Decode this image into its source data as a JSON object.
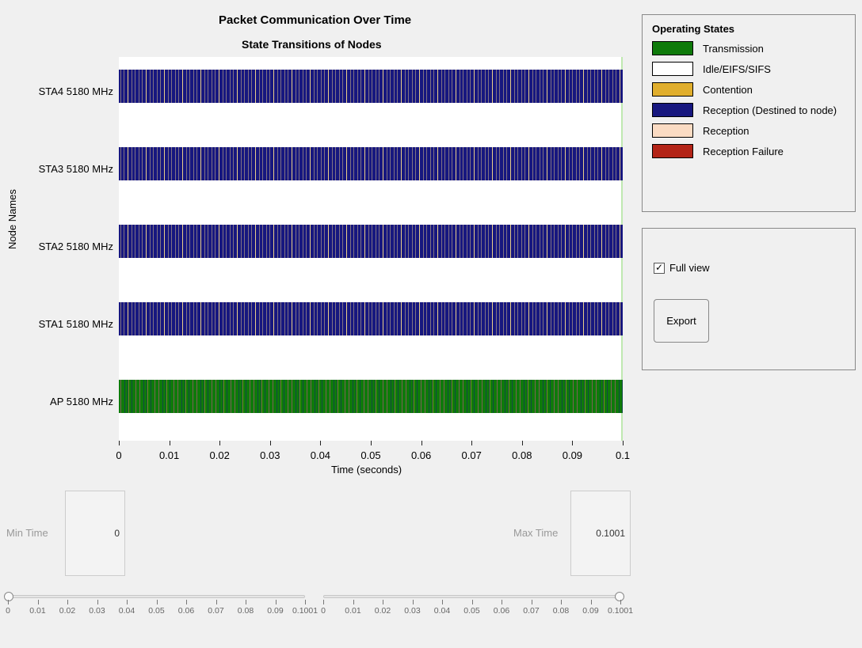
{
  "titles": {
    "main": "Packet Communication Over Time",
    "sub": "State Transitions of Nodes",
    "ylabel": "Node Names",
    "xlabel": "Time (seconds)"
  },
  "legend": {
    "title": "Operating States",
    "items": {
      "tx": "Transmission",
      "idle": "Idle/EIFS/SIFS",
      "cont": "Contention",
      "rxd": "Reception (Destined to node)",
      "rx": "Reception",
      "rxf": "Reception Failure"
    }
  },
  "controls": {
    "fullview": "Full view",
    "export": "Export"
  },
  "time_inputs": {
    "min_label": "Min Time",
    "max_label": "Max Time",
    "min_val": "0",
    "max_val": "0.1001"
  },
  "chart_data": {
    "type": "timeline/state-gantt",
    "title": "Packet Communication Over Time",
    "subtitle": "State Transitions of Nodes",
    "xlabel": "Time (seconds)",
    "ylabel": "Node Names",
    "xlim": [
      0,
      0.1
    ],
    "x_ticks": [
      0,
      0.01,
      0.02,
      0.03,
      0.04,
      0.05,
      0.06,
      0.07,
      0.08,
      0.09,
      0.1
    ],
    "nodes": [
      "STA4 5180 MHz",
      "STA3 5180 MHz",
      "STA2 5180 MHz",
      "STA1 5180 MHz",
      "AP 5180 MHz"
    ],
    "states": [
      "Transmission",
      "Idle/EIFS/SIFS",
      "Contention",
      "Reception (Destined to node)",
      "Reception",
      "Reception Failure"
    ],
    "state_colors": {
      "Transmission": "#0e7a0a",
      "Idle/EIFS/SIFS": "#ffffff",
      "Contention": "#e0ae2d",
      "Reception (Destined to node)": "#17177f",
      "Reception": "#fadbc3",
      "Reception Failure": "#b32417"
    },
    "dominant_state_per_node": {
      "STA4 5180 MHz": "Reception (Destined to node)",
      "STA3 5180 MHz": "Reception (Destined to node)",
      "STA2 5180 MHz": "Reception (Destined to node)",
      "STA1 5180 MHz": "Reception (Destined to node)",
      "AP 5180 MHz": "Transmission"
    },
    "note": "Each row is a dense sequence of very short alternating state slices across the full 0–0.1s window; individual transition times are not readable at this resolution."
  },
  "slider_ticks": [
    "0",
    "0.01",
    "0.02",
    "0.03",
    "0.04",
    "0.05",
    "0.06",
    "0.07",
    "0.08",
    "0.09",
    "0.1001"
  ]
}
